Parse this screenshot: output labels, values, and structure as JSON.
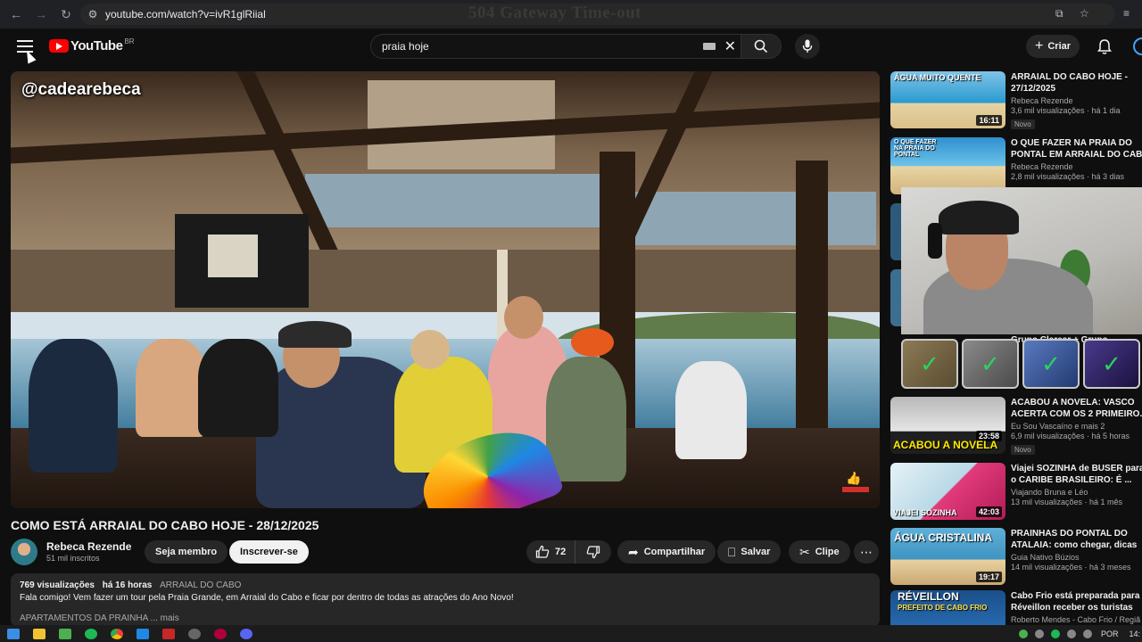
{
  "browser": {
    "url": "youtube.com/watch?v=ivR1glRiial",
    "page_heading": "504 Gateway Time-out",
    "back_icon": "arrow-left-icon",
    "forward_icon": "arrow-right-icon",
    "reload_icon": "reload-icon"
  },
  "header": {
    "logo_text": "YouTube",
    "country_code": "BR",
    "search_query": "praia hoje",
    "create_label": "Criar",
    "brand_color": "#ff0000"
  },
  "video": {
    "watermark": "@cadearebeca",
    "title": "COMO ESTÁ ARRAIAL DO CABO HOJE - 28/12/2025",
    "channel_name": "Rebeca Rezende",
    "subscribers": "51 mil inscritos",
    "join_label": "Seja membro",
    "subscribe_label": "Inscrever-se",
    "likes": "72",
    "share_label": "Compartilhar",
    "save_label": "Salvar",
    "clip_label": "Clipe"
  },
  "description": {
    "views": "769 visualizações",
    "age": "há 16 horas",
    "tag": "ARRAIAL DO CABO",
    "text": "Fala comigo! Vem fazer um tour pela Praia Grande, em Arraial do Cabo e ficar por dentro de todas as atrações do Ano Novo!",
    "line2": "APARTAMENTOS DA PRAINHA ... mais"
  },
  "sidebar": [
    {
      "title": "ARRAIAL DO CABO HOJE -",
      "title2": "27/12/2025",
      "channel": "Rebeca Rezende",
      "meta": "3,6 mil visualizações · há 1 dia",
      "badge": "Novo",
      "duration": "16:11",
      "overlay": "ÁGUA MUITO QUENTE"
    },
    {
      "title": "O QUE FAZER NA PRAIA DO",
      "title2": "PONTAL EM ARRAIAL DO CAB",
      "channel": "Rebeca Rezende",
      "meta": "2,8 mil visualizações · há 3 dias",
      "overlay": "O QUE FAZER NA PRAIA DO PONTAL"
    },
    {
      "title": "ACABOU A NOVELA: VASCO",
      "title2": "ACERTA COM OS 2 PRIMEIRO.",
      "channel": "Eu Sou Vascaíno e mais 2",
      "meta": "6,9 mil visualizações · há 5 horas",
      "badge": "Novo",
      "duration": "23:58",
      "overlay_bottom": "ACABOU A NOVELA"
    },
    {
      "title": "Viajei SOZINHA de BUSER para",
      "title2": "o CARIBE BRASILEIRO: É ...",
      "channel": "Viajando Bruna e Léo",
      "meta": "13 mil visualizações · há 1 mês",
      "duration": "42:03",
      "overlay_bottom": "VIAJEI SOZINHA"
    },
    {
      "title": "PRAINHAS DO PONTAL DO",
      "title2": "ATALAIA: como chegar, dicas",
      "channel": "Guia Nativo Búzios",
      "meta": "14 mil visualizações · há 3 meses",
      "duration": "19:17",
      "overlay": "ÁGUA CRISTALINA"
    },
    {
      "title": "Cabo Frio está preparada para",
      "title2": "Réveillon receber os turistas",
      "channel": "Roberto Mendes - Cabo Frio / Regiã",
      "overlay": "RÉVEILLON",
      "overlay2": "PREFEITO DE CABO FRIO"
    }
  ],
  "partial_title": "Grupo Clarear + Grupo",
  "taskbar": {
    "language": "POR",
    "time": "14:"
  }
}
